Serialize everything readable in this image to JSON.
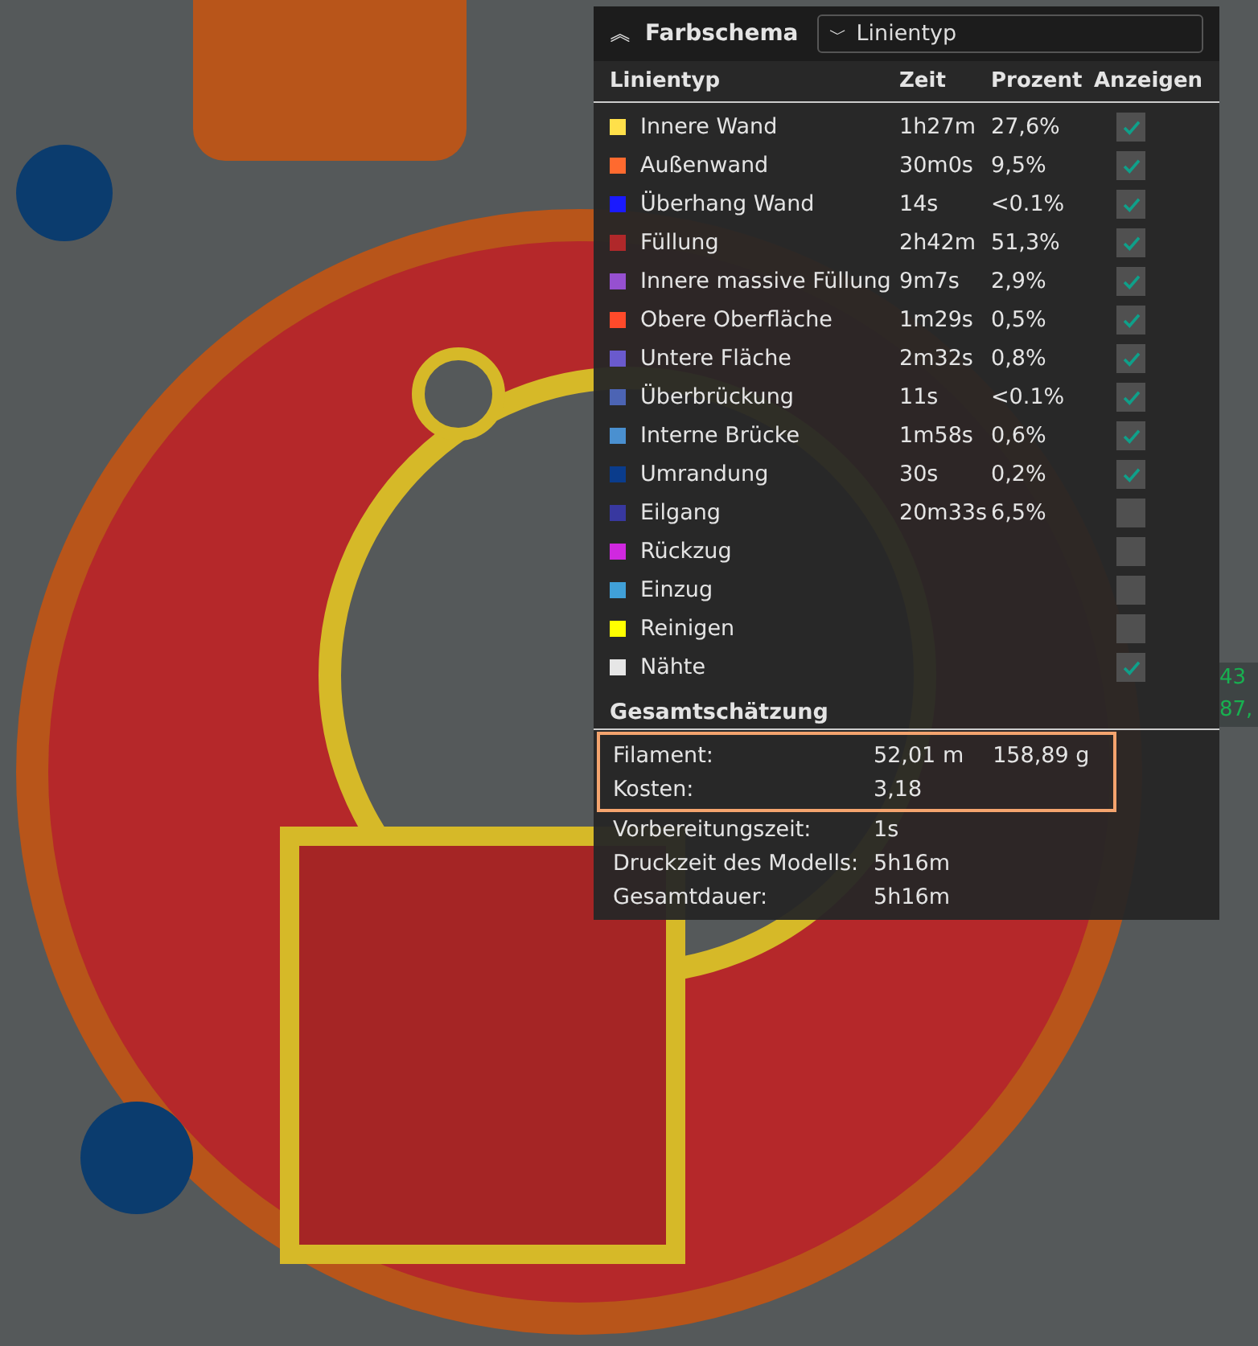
{
  "panel": {
    "title": "Farbschema",
    "scheme_dropdown": {
      "value": "Linientyp",
      "collapse_glyph": "︽",
      "caret_glyph": "﹀"
    }
  },
  "table": {
    "columns": [
      "Linientyp",
      "Zeit",
      "Prozent",
      "Anzeigen"
    ],
    "rows": [
      {
        "name": "Innere Wand",
        "time": "1h27m",
        "percent": "27,6%",
        "color": "#ffe04a",
        "checked": true
      },
      {
        "name": "Außenwand",
        "time": "30m0s",
        "percent": "9,5%",
        "color": "#ff6a2f",
        "checked": true
      },
      {
        "name": "Überhang Wand",
        "time": "14s",
        "percent": "<0.1%",
        "color": "#1a1aff",
        "checked": true
      },
      {
        "name": "Füllung",
        "time": "2h42m",
        "percent": "51,3%",
        "color": "#b0282a",
        "checked": true
      },
      {
        "name": "Innere massive Füllung",
        "time": "9m7s",
        "percent": "2,9%",
        "color": "#9650d0",
        "checked": true
      },
      {
        "name": "Obere Oberfläche",
        "time": "1m29s",
        "percent": "0,5%",
        "color": "#ff4a2a",
        "checked": true
      },
      {
        "name": "Untere Fläche",
        "time": "2m32s",
        "percent": "0,8%",
        "color": "#6a5acd",
        "checked": true
      },
      {
        "name": "Überbrückung",
        "time": "11s",
        "percent": "<0.1%",
        "color": "#4c64b4",
        "checked": true
      },
      {
        "name": "Interne Brücke",
        "time": "1m58s",
        "percent": "0,6%",
        "color": "#4a90d0",
        "checked": true
      },
      {
        "name": "Umrandung",
        "time": "30s",
        "percent": "0,2%",
        "color": "#0a3c8c",
        "checked": true
      },
      {
        "name": "Eilgang",
        "time": "20m33s",
        "percent": "6,5%",
        "color": "#3838a0",
        "checked": false
      },
      {
        "name": "Rückzug",
        "color": "#d028e0",
        "checked": false
      },
      {
        "name": "Einzug",
        "color": "#40a0d8",
        "checked": false
      },
      {
        "name": "Reinigen",
        "color": "#ffff00",
        "checked": false
      },
      {
        "name": "Nähte",
        "color": "#e6e6e6",
        "checked": true
      }
    ]
  },
  "estimate": {
    "title": "Gesamtschätzung",
    "rows": [
      {
        "label": "Filament:",
        "value": "52,01 m",
        "extra": "158,89 g",
        "highlighted": true
      },
      {
        "label": "Kosten:",
        "value": "3,18",
        "highlighted": true
      },
      {
        "label": "Vorbereitungszeit:",
        "value": "1s",
        "highlighted": false
      },
      {
        "label": "Druckzeit des Modells:",
        "value": "5h16m",
        "highlighted": false
      },
      {
        "label": "Gesamtdauer:",
        "value": "5h16m",
        "highlighted": false
      }
    ]
  },
  "edge_label": {
    "lines": [
      "43",
      "87,"
    ]
  }
}
